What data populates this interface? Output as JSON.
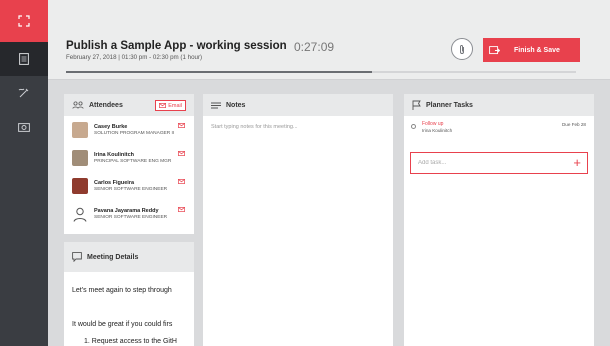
{
  "session": {
    "title": "Publish a Sample App - working session",
    "subtitle": "February 27, 2018 | 01:30 pm - 02:30 pm (1 hour)",
    "timer": "0:27:09",
    "progress_fraction": 0.6,
    "finish_label": "Finish & Save"
  },
  "attendees": {
    "title": "Attendees",
    "email_label": "Email",
    "people": [
      {
        "name": "Casey Burke",
        "role": "SOLUTION PROGRAM MANAGER II"
      },
      {
        "name": "Irina Koulinitch",
        "role": "PRINCIPAL SOFTWARE ENG MGR"
      },
      {
        "name": "Carlos Figueira",
        "role": "SENIOR SOFTWARE ENGINEER"
      },
      {
        "name": "Pavana Jayarama Reddy",
        "role": "SENIOR SOFTWARE ENGINEER"
      }
    ]
  },
  "details": {
    "title": "Meeting Details",
    "line1": "Let's meet again to step through",
    "line2": "It would be great if you could firs",
    "line3": "1.  Request access to the GitH"
  },
  "notes": {
    "title": "Notes",
    "placeholder": "Start typing notes for this meeting..."
  },
  "planner": {
    "title": "Planner Tasks",
    "tasks": [
      {
        "name": "Follow up",
        "assignee": "Irina Koulinitch",
        "due": "Due Feb 28"
      }
    ],
    "add_placeholder": "Add task..."
  },
  "colors": {
    "accent": "#e8414d",
    "rail": "#3a3d42"
  }
}
